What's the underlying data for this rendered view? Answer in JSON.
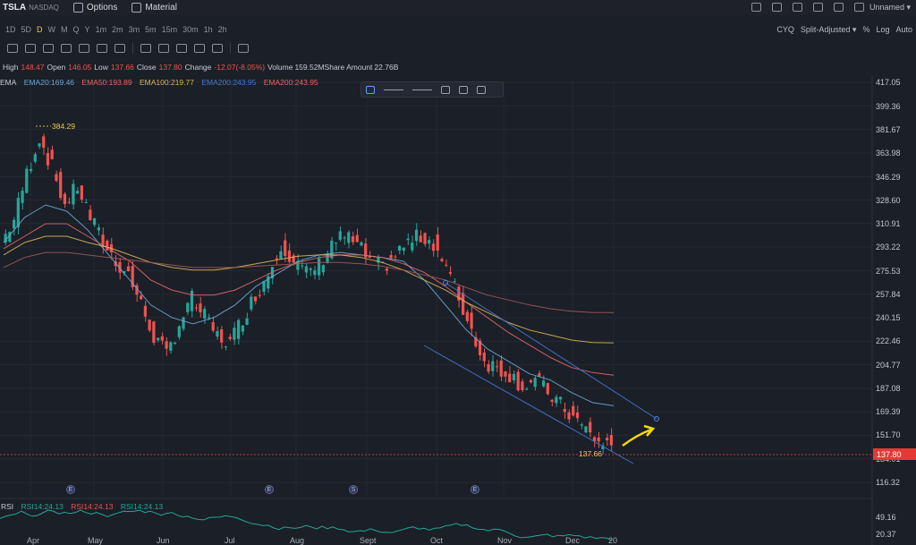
{
  "top": {
    "ticker": "TSLA",
    "exchange": "NASDAQ",
    "options_label": "Options",
    "material_label": "Material",
    "layout_name": "Unnamed"
  },
  "intervals": [
    "1D",
    "5D",
    "D",
    "W",
    "M",
    "Q",
    "Y",
    "1m",
    "2m",
    "3m",
    "5m",
    "15m",
    "30m",
    "1h",
    "2h"
  ],
  "active_interval": "D",
  "chart_options": {
    "cyq": "CYQ",
    "adjust": "Split-Adjusted",
    "percent": "%",
    "log": "Log",
    "auto": "Auto"
  },
  "ohlc": {
    "high_label": "High",
    "high": "148.47",
    "open_label": "Open",
    "open": "146.05",
    "low_label": "Low",
    "low": "137.66",
    "close_label": "Close",
    "close": "137.80",
    "change_label": "Change",
    "change": "-12.07(-8.05%)",
    "volume_label": "Volume",
    "volume": "159.52M",
    "amount_label": "Share Amount",
    "amount": "22.76B"
  },
  "ema": {
    "label": "EMA",
    "ema20": "EMA20:169.46",
    "ema50": "EMA50:193.89",
    "ema100": "EMA100:219.77",
    "ema200a": "EMA200:243.95",
    "ema200b": "EMA200:243.95"
  },
  "colors": {
    "up": "#26a69a",
    "down": "#ef5350",
    "ema20": "#6aa7d8",
    "ema50": "#e0686a",
    "ema100": "#d9b45a",
    "ema200": "#a05a5a",
    "channel": "#3f6fc4",
    "arrow": "#f5d90a",
    "rsi": "#26a69a"
  },
  "price_axis": [
    "417.05",
    "399.36",
    "381.67",
    "363.98",
    "346.29",
    "328.60",
    "310.91",
    "293.22",
    "275.53",
    "257.84",
    "240.15",
    "222.46",
    "204.77",
    "187.08",
    "169.39",
    "151.70",
    "134.01",
    "116.32"
  ],
  "current_price": "137.80",
  "high_marker": "384.29",
  "low_marker": "137.66",
  "time_axis": [
    "Apr",
    "May",
    "Jun",
    "Jul",
    "Aug",
    "Sept",
    "Oct",
    "Nov",
    "Dec",
    "20"
  ],
  "events": [
    "E",
    "E",
    "S",
    "E"
  ],
  "rsi": {
    "label": "RSI",
    "v1": "RSI14:24.13",
    "v2": "RSI14:24.13",
    "v3": "RSI14:24.13",
    "axis": [
      "49.16",
      "20.37"
    ]
  },
  "chart_data": {
    "type": "line",
    "title": "",
    "xlabel": "",
    "ylabel": "",
    "ylim": [
      107.5,
      425.9
    ],
    "x": [
      "Apr",
      "May",
      "Jun",
      "Jul",
      "Aug",
      "Sept",
      "Oct",
      "Nov",
      "Dec",
      "20"
    ],
    "close_path": [
      300,
      318,
      355,
      384,
      360,
      330,
      345,
      320,
      300,
      285,
      275,
      250,
      225,
      210,
      235,
      255,
      240,
      225,
      220,
      240,
      258,
      275,
      300,
      285,
      275,
      282,
      300,
      305,
      298,
      285,
      280,
      290,
      300,
      305,
      300,
      280,
      255,
      230,
      205,
      200,
      195,
      185,
      190,
      180,
      170,
      160,
      150,
      140,
      137.8
    ],
    "series": [
      {
        "name": "EMA20",
        "values": [
          300,
          320,
          330,
          325,
          310,
          290,
          270,
          250,
          240,
          235,
          240,
          250,
          265,
          275,
          285,
          290,
          292,
          290,
          288,
          285,
          270,
          250,
          230,
          215,
          205,
          195,
          190,
          180,
          172,
          169.46
        ]
      },
      {
        "name": "EMA50",
        "values": [
          295,
          305,
          315,
          315,
          305,
          295,
          285,
          270,
          262,
          258,
          258,
          262,
          270,
          278,
          284,
          288,
          290,
          290,
          288,
          283,
          276,
          265,
          252,
          240,
          228,
          218,
          208,
          200,
          196,
          193.89
        ]
      },
      {
        "name": "EMA100",
        "values": [
          290,
          300,
          305,
          305,
          300,
          296,
          290,
          284,
          280,
          278,
          278,
          280,
          283,
          286,
          289,
          290,
          290,
          288,
          284,
          278,
          270,
          262,
          252,
          244,
          236,
          230,
          226,
          222,
          220,
          219.77
        ]
      },
      {
        "name": "EMA200",
        "values": [
          280,
          288,
          292,
          292,
          290,
          288,
          286,
          284,
          282,
          280,
          280,
          280,
          281,
          282,
          283,
          284,
          284,
          283,
          281,
          278,
          274,
          270,
          264,
          258,
          254,
          250,
          247,
          245,
          244,
          243.95
        ]
      }
    ]
  }
}
